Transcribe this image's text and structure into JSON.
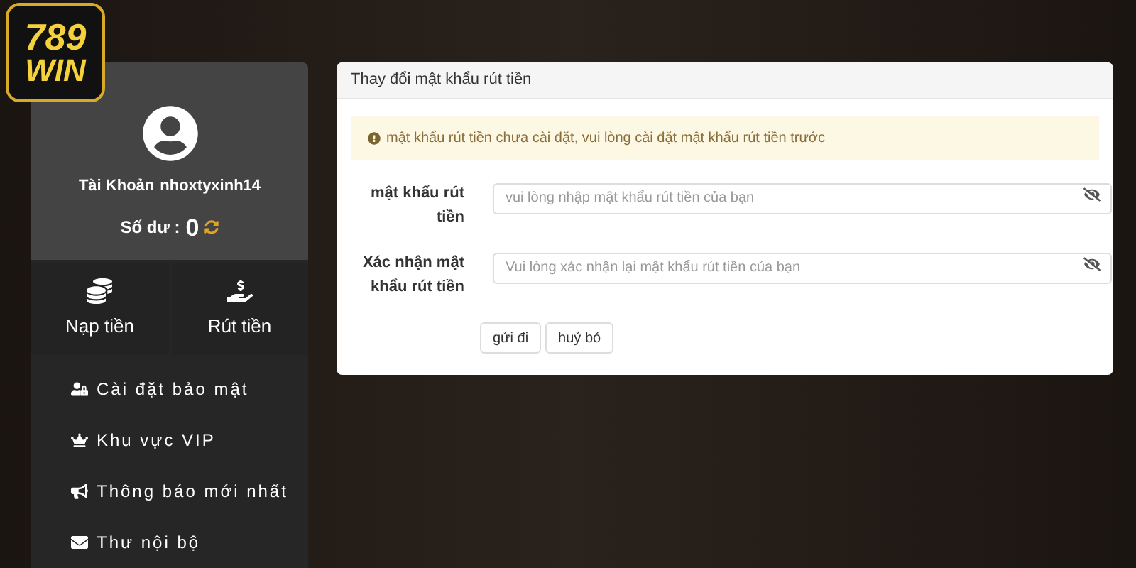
{
  "logo": {
    "number": "789",
    "word": "WIN"
  },
  "profile": {
    "account_label": "Tài Khoản",
    "username": "nhoxtyxinh14",
    "balance_label": "Số dư :",
    "balance": "0"
  },
  "actions": [
    {
      "kind": "deposit",
      "label": "Nạp tiền"
    },
    {
      "kind": "withdraw",
      "label": "Rút tiền"
    }
  ],
  "menu": [
    {
      "kind": "security",
      "label": "Cài đặt bảo mật"
    },
    {
      "kind": "vip",
      "label": "Khu vực VIP"
    },
    {
      "kind": "news",
      "label": "Thông báo mới nhất"
    },
    {
      "kind": "mail",
      "label": "Thư nội bộ"
    }
  ],
  "panel": {
    "title": "Thay đổi mật khẩu rút tiền",
    "alert": "mật khẩu rút tiền chưa cài đặt, vui lòng cài đặt mật khẩu rút tiền trước",
    "fields": [
      {
        "label": "mật khẩu rút tiền",
        "placeholder": "vui lòng nhập mật khẩu rút tiền của bạn"
      },
      {
        "label": "Xác nhận mật khẩu rút tiền",
        "placeholder": "Vui lòng xác nhận lại mật khẩu rút tiền của bạn"
      }
    ],
    "buttons": [
      "gửi đi",
      "huỷ bỏ"
    ]
  }
}
